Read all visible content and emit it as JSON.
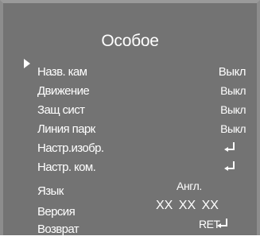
{
  "menu": {
    "title": "Особое",
    "items": [
      {
        "label": "Назв. кам",
        "value": "Выкл"
      },
      {
        "label": "Движение",
        "value": "Выкл"
      },
      {
        "label": "Защ сист",
        "value": "Выкл"
      },
      {
        "label": "Линия парк",
        "value": "Выкл"
      },
      {
        "label": "Настр.изобр.",
        "value": ""
      },
      {
        "label": "Настр. ком.",
        "value": ""
      },
      {
        "label": "Язык",
        "value": "Англ."
      },
      {
        "label": "Версия",
        "value": "XX  XX  XX"
      },
      {
        "label": "Возврат",
        "value": "RET"
      }
    ],
    "cursor_icon": "right-triangle-cursor-icon",
    "enter_icon": "enter-return-arrow-icon"
  }
}
